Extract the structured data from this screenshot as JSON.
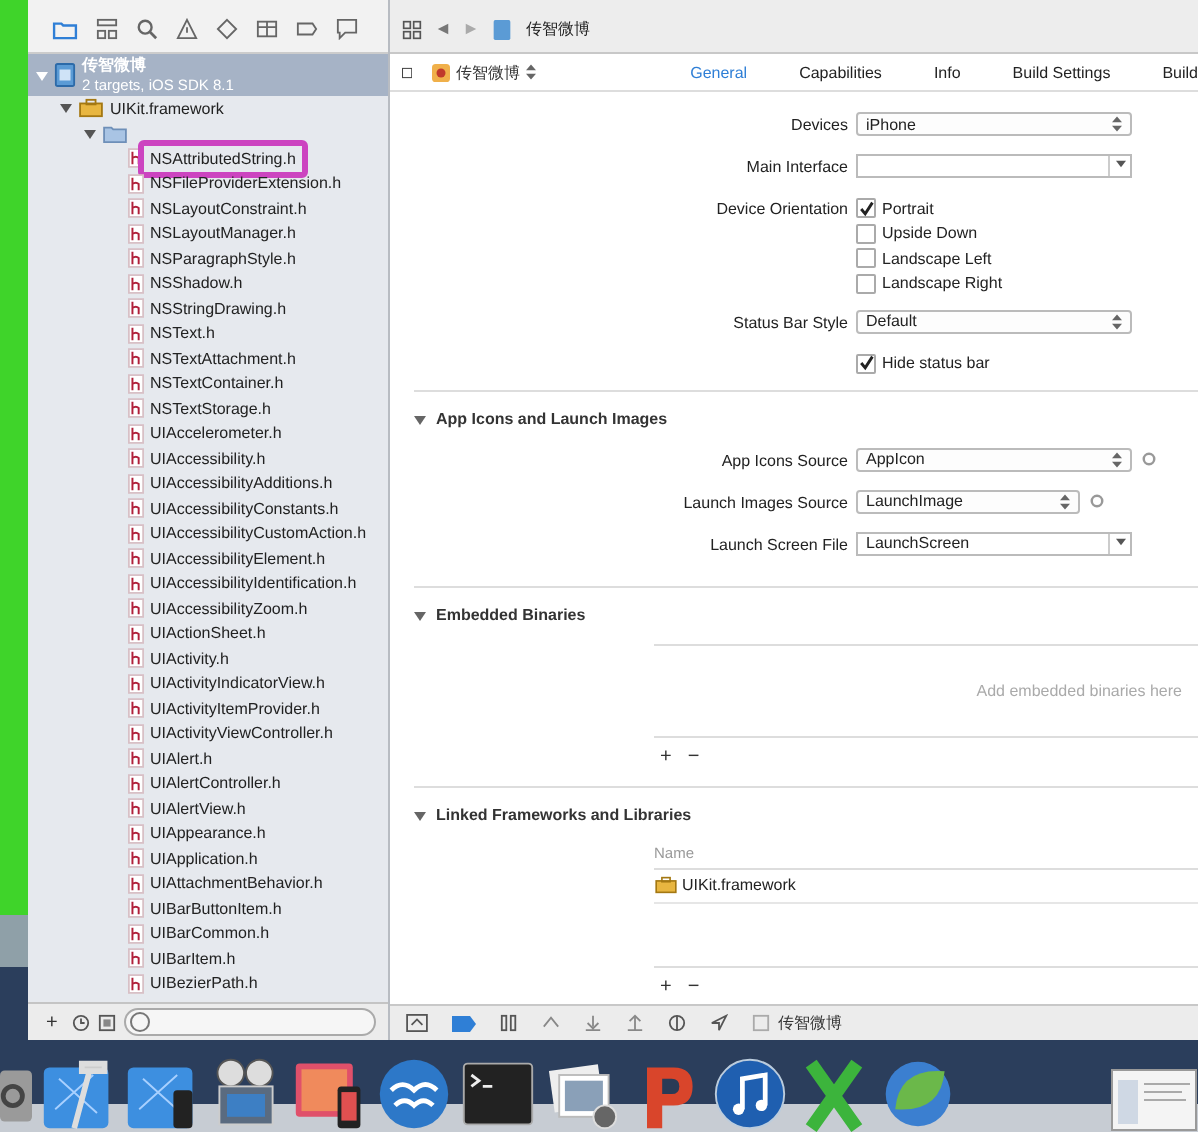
{
  "navigator": {
    "tree": [
      {
        "kind": "project",
        "name": "传智微博",
        "subtitle": "2 targets, iOS SDK 8.1",
        "expanded": true,
        "children": [
          {
            "kind": "framework",
            "name": "UIKit.framework",
            "expanded": true,
            "children": [
              {
                "kind": "folder",
                "expanded": true,
                "children": [
                  {
                    "kind": "header",
                    "name": "NSAttributedString.h",
                    "highlighted": true
                  },
                  {
                    "kind": "header",
                    "name": "NSFileProviderExtension.h",
                    "highlighted": false
                  },
                  {
                    "kind": "header",
                    "name": "NSLayoutConstraint.h",
                    "highlighted": false
                  },
                  {
                    "kind": "header",
                    "name": "NSLayoutManager.h",
                    "highlighted": false
                  },
                  {
                    "kind": "header",
                    "name": "NSParagraphStyle.h",
                    "highlighted": false
                  },
                  {
                    "kind": "header",
                    "name": "NSShadow.h",
                    "highlighted": false
                  },
                  {
                    "kind": "header",
                    "name": "NSStringDrawing.h",
                    "highlighted": false
                  },
                  {
                    "kind": "header",
                    "name": "NSText.h",
                    "highlighted": false
                  },
                  {
                    "kind": "header",
                    "name": "NSTextAttachment.h",
                    "highlighted": false
                  },
                  {
                    "kind": "header",
                    "name": "NSTextContainer.h",
                    "highlighted": false
                  },
                  {
                    "kind": "header",
                    "name": "NSTextStorage.h",
                    "highlighted": false
                  },
                  {
                    "kind": "header",
                    "name": "UIAccelerometer.h",
                    "highlighted": false
                  },
                  {
                    "kind": "header",
                    "name": "UIAccessibility.h",
                    "highlighted": false
                  },
                  {
                    "kind": "header",
                    "name": "UIAccessibilityAdditions.h",
                    "highlighted": false
                  },
                  {
                    "kind": "header",
                    "name": "UIAccessibilityConstants.h",
                    "highlighted": false
                  },
                  {
                    "kind": "header",
                    "name": "UIAccessibilityCustomAction.h",
                    "highlighted": false
                  },
                  {
                    "kind": "header",
                    "name": "UIAccessibilityElement.h",
                    "highlighted": false
                  },
                  {
                    "kind": "header",
                    "name": "UIAccessibilityIdentification.h",
                    "highlighted": false
                  },
                  {
                    "kind": "header",
                    "name": "UIAccessibilityZoom.h",
                    "highlighted": false
                  },
                  {
                    "kind": "header",
                    "name": "UIActionSheet.h",
                    "highlighted": false
                  },
                  {
                    "kind": "header",
                    "name": "UIActivity.h",
                    "highlighted": false
                  },
                  {
                    "kind": "header",
                    "name": "UIActivityIndicatorView.h",
                    "highlighted": false
                  },
                  {
                    "kind": "header",
                    "name": "UIActivityItemProvider.h",
                    "highlighted": false
                  },
                  {
                    "kind": "header",
                    "name": "UIActivityViewController.h",
                    "highlighted": false
                  },
                  {
                    "kind": "header",
                    "name": "UIAlert.h",
                    "highlighted": false
                  },
                  {
                    "kind": "header",
                    "name": "UIAlertController.h",
                    "highlighted": false
                  },
                  {
                    "kind": "header",
                    "name": "UIAlertView.h",
                    "highlighted": false
                  },
                  {
                    "kind": "header",
                    "name": "UIAppearance.h",
                    "highlighted": false
                  },
                  {
                    "kind": "header",
                    "name": "UIApplication.h",
                    "highlighted": false
                  },
                  {
                    "kind": "header",
                    "name": "UIAttachmentBehavior.h",
                    "highlighted": false
                  },
                  {
                    "kind": "header",
                    "name": "UIBarButtonItem.h",
                    "highlighted": false
                  },
                  {
                    "kind": "header",
                    "name": "UIBarCommon.h",
                    "highlighted": false
                  },
                  {
                    "kind": "header",
                    "name": "UIBarItem.h",
                    "highlighted": false
                  },
                  {
                    "kind": "header",
                    "name": "UIBezierPath.h",
                    "highlighted": false
                  }
                ]
              }
            ]
          }
        ]
      }
    ],
    "bottom_bar": {
      "add": "+"
    }
  },
  "jump_bar": {
    "crumb": "传智微博"
  },
  "target_selector": {
    "name": "传智微博"
  },
  "tabs": [
    {
      "label": "General",
      "selected": true
    },
    {
      "label": "Capabilities",
      "selected": false
    },
    {
      "label": "Info",
      "selected": false
    },
    {
      "label": "Build Settings",
      "selected": false
    },
    {
      "label": "Build",
      "selected": false
    }
  ],
  "deployment_rows": [
    {
      "kind": "popup",
      "label": "Devices",
      "value": "iPhone"
    },
    {
      "kind": "combo",
      "label": "Main Interface"
    },
    {
      "kind": "checks",
      "label": "Device Orientation",
      "options": [
        {
          "label": "Portrait",
          "checked": true
        },
        {
          "label": "Upside Down",
          "checked": false
        },
        {
          "label": "Landscape Left",
          "checked": false
        },
        {
          "label": "Landscape Right",
          "checked": false
        }
      ]
    },
    {
      "kind": "popup",
      "label": "Status Bar Style",
      "value": "Default"
    },
    {
      "kind": "checks",
      "options": [
        {
          "label": "Hide status bar",
          "checked": true
        }
      ]
    }
  ],
  "sections": [
    {
      "kind": "form",
      "title": "App Icons and Launch Images",
      "expanded": true,
      "rows": [
        {
          "kind": "popup",
          "label": "App Icons Source",
          "value": "AppIcon",
          "info": true
        },
        {
          "kind": "popup",
          "label": "Launch Images Source",
          "value": "LaunchImage",
          "info": true
        },
        {
          "kind": "combo",
          "label": "Launch Screen File",
          "value": "LaunchScreen"
        }
      ]
    },
    {
      "kind": "table",
      "title": "Embedded Binaries",
      "expanded": true,
      "placeholder": "Add embedded binaries here",
      "add": "+",
      "remove": "−"
    },
    {
      "kind": "table",
      "title": "Linked Frameworks and Libraries",
      "expanded": true,
      "column": "Name",
      "items": [
        "UIKit.framework"
      ],
      "add": "+",
      "remove": "−"
    }
  ],
  "debug_bar": {
    "target": "传智微博"
  }
}
